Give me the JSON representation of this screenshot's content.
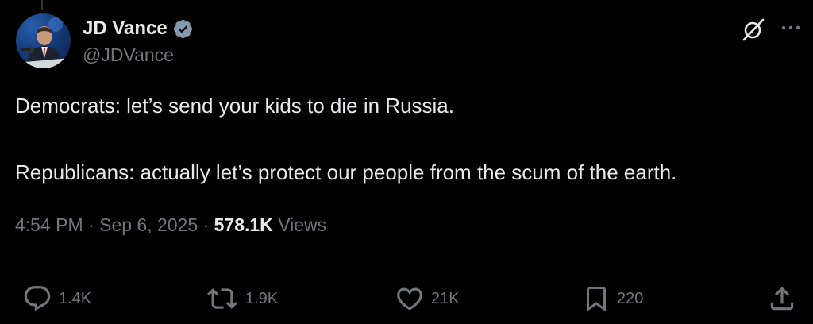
{
  "author": {
    "display_name": "JD Vance",
    "handle": "@JDVance",
    "verified": true,
    "verified_color": "#829aab"
  },
  "tweet": {
    "lines": [
      "Democrats: let’s send your kids to die in Russia.",
      "Republicans: actually let’s protect our people from the scum of the earth."
    ],
    "time": "4:54 PM",
    "separator": "·",
    "date": "Sep 6, 2025",
    "views_count": "578.1K",
    "views_label": "Views"
  },
  "actions": {
    "replies": "1.4K",
    "reposts": "1.9K",
    "likes": "21K",
    "bookmarks": "220"
  },
  "icons": {
    "grok": "grok-icon",
    "more": "more-icon",
    "reply": "reply-icon",
    "repost": "repost-icon",
    "like": "heart-icon",
    "bookmark": "bookmark-icon",
    "share": "share-icon"
  },
  "colors": {
    "background": "#000000",
    "primary_text": "#e7e9ea",
    "secondary_text": "#71767b",
    "divider": "#2f3336"
  }
}
